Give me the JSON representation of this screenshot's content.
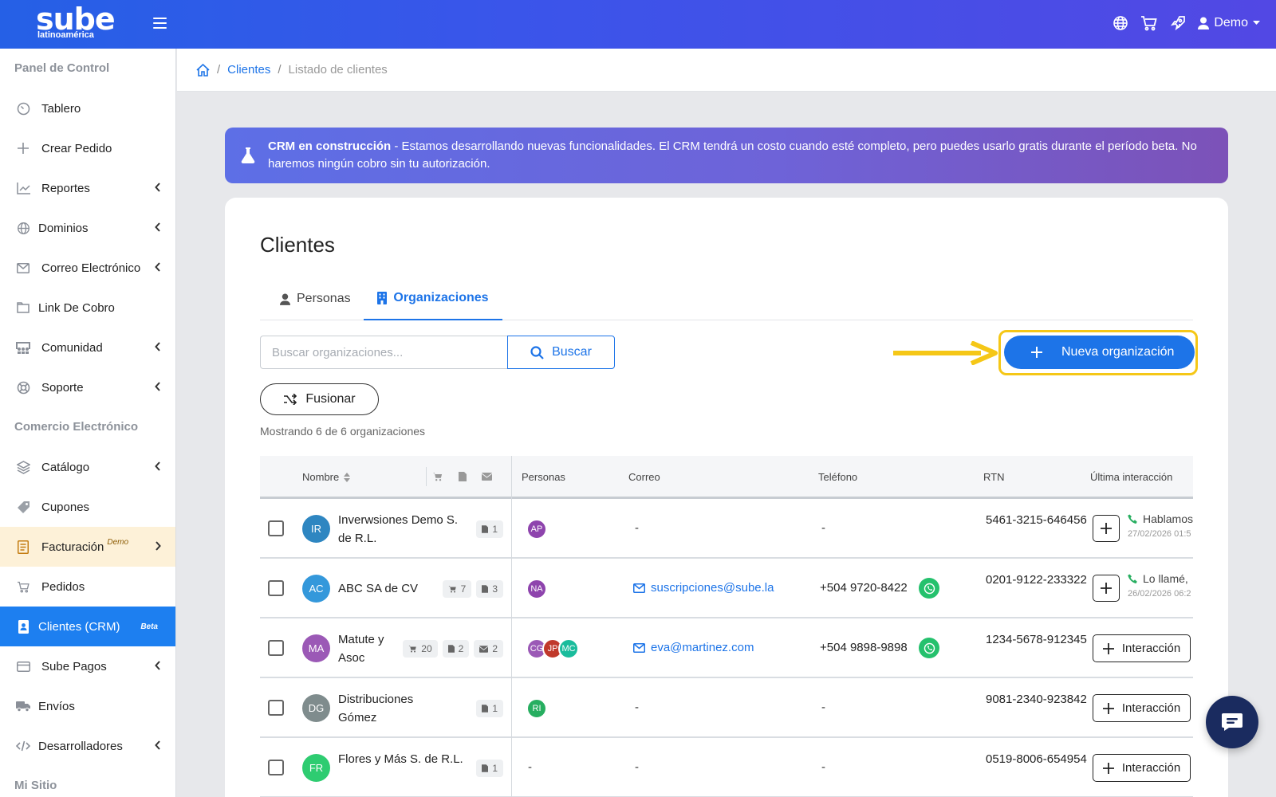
{
  "brand": {
    "name": "sube",
    "sub": "latinoamérica"
  },
  "user": {
    "name": "Demo"
  },
  "sidebar": {
    "sections": [
      "Panel de Control",
      "Comercio Electrónico",
      "Mi Sitio"
    ],
    "items": [
      {
        "label": "Tablero",
        "icon": "gauge-icon"
      },
      {
        "label": "Crear Pedido",
        "icon": "plus-icon"
      },
      {
        "label": "Reportes",
        "icon": "chart-line-icon",
        "chevron": true
      },
      {
        "label": "Dominios",
        "icon": "globe-icon",
        "chevron": true
      },
      {
        "label": "Correo Electrónico",
        "icon": "envelope-icon",
        "chevron": true
      },
      {
        "label": "Link De Cobro",
        "icon": "folder-icon"
      },
      {
        "label": "Comunidad",
        "icon": "community-icon",
        "chevron": true
      },
      {
        "label": "Soporte",
        "icon": "life-ring-icon",
        "chevron": true
      },
      {
        "label": "Catálogo",
        "icon": "layers-icon",
        "chevron": true
      },
      {
        "label": "Cupones",
        "icon": "tag-icon"
      },
      {
        "label": "Facturación",
        "sup": "Demo",
        "icon": "receipt-icon",
        "chevron": true
      },
      {
        "label": "Pedidos",
        "icon": "cart-icon"
      },
      {
        "label": "Clientes (CRM)",
        "badge": "Beta",
        "icon": "contact-book-icon"
      },
      {
        "label": "Sube Pagos",
        "icon": "credit-card-icon",
        "chevron": true
      },
      {
        "label": "Envíos",
        "icon": "truck-icon"
      },
      {
        "label": "Desarrolladores",
        "icon": "code-icon",
        "chevron": true
      }
    ]
  },
  "breadcrumb": {
    "link": "Clientes",
    "current": "Listado de clientes"
  },
  "banner": {
    "title": "CRM en construcción",
    "text": " - Estamos desarrollando nuevas funcionalidades. El CRM tendrá un costo cuando esté completo, pero puedes usarlo gratis durante el período beta. No haremos ningún cobro sin tu autorización."
  },
  "page": {
    "title": "Clientes"
  },
  "tabs": {
    "personas": "Personas",
    "organizaciones": "Organizaciones"
  },
  "search": {
    "placeholder": "Buscar organizaciones...",
    "button": "Buscar"
  },
  "actions": {
    "merge": "Fusionar",
    "new_org": "Nueva organización"
  },
  "count_text": "Mostrando 6 de 6 organizaciones",
  "table": {
    "headers": {
      "name": "Nombre",
      "people": "Personas",
      "email": "Correo",
      "phone": "Teléfono",
      "rtn": "RTN",
      "last": "Última interacción"
    },
    "rows": [
      {
        "initials": "IR",
        "color": "#2e86c1",
        "name": "Inverwsiones Demo S. de R.L.",
        "cart": "",
        "docs": "1",
        "mail": "",
        "people": [
          {
            "i": "AP",
            "c": "#8e44ad"
          }
        ],
        "email": "-",
        "phone": "-",
        "rtn": "5461-3215-646456",
        "last_text": "Hablamos",
        "last_date": "27/02/2026 01:5"
      },
      {
        "initials": "AC",
        "color": "#3498db",
        "name": "ABC SA de CV",
        "cart": "7",
        "docs": "3",
        "mail": "",
        "people": [
          {
            "i": "NA",
            "c": "#8e44ad"
          }
        ],
        "email": "suscripciones@sube.la",
        "phone": "+504 9720-8422",
        "rtn": "0201-9122-233322",
        "last_text": "Lo llamé,",
        "last_date": "26/02/2026 06:2"
      },
      {
        "initials": "MA",
        "color": "#9b59b6",
        "name": "Matute y Asoc",
        "cart": "20",
        "docs": "2",
        "mail": "2",
        "people": [
          {
            "i": "CG",
            "c": "#9b59b6"
          },
          {
            "i": "JP",
            "c": "#c0392b"
          },
          {
            "i": "MC",
            "c": "#1abc9c"
          }
        ],
        "email": "eva@martinez.com",
        "phone": "+504 9898-9898",
        "rtn": "1234-5678-912345",
        "interaction": "Interacción"
      },
      {
        "initials": "DG",
        "color": "#7f8c8d",
        "name": "Distribuciones Gómez",
        "cart": "",
        "docs": "1",
        "mail": "",
        "people": [
          {
            "i": "RI",
            "c": "#27ae60"
          }
        ],
        "email": "-",
        "phone": "-",
        "rtn": "9081-2340-923842",
        "interaction": "Interacción"
      },
      {
        "initials": "FR",
        "color": "#2ecc71",
        "name": "Flores y Más S. de R.L.",
        "cart": "",
        "docs": "1",
        "mail": "",
        "people": [],
        "people_text": "-",
        "email": "-",
        "phone": "-",
        "rtn": "0519-8006-654954",
        "interaction": "Interacción"
      }
    ]
  },
  "colors": {
    "primary": "#1d74e8",
    "highlight": "#f5c717",
    "sidebar_active": "#1d7ff0",
    "whatsapp": "#25c16d"
  }
}
